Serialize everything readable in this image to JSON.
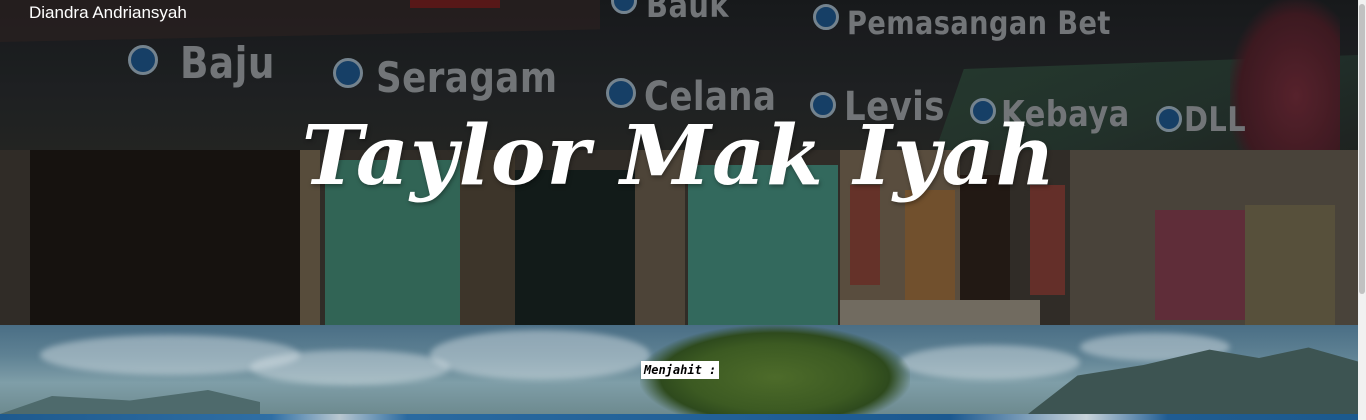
{
  "header": {
    "author": "Diandra Andriansyah",
    "title": "Taylor Mak Iyah"
  },
  "hero_banner": {
    "words": [
      "Baju",
      "Seragam",
      "Celana",
      "Levis",
      "Kebaya",
      "DLL",
      "Pemasangan Bet",
      "Bauk"
    ]
  },
  "section": {
    "label": "Menjahit :"
  }
}
